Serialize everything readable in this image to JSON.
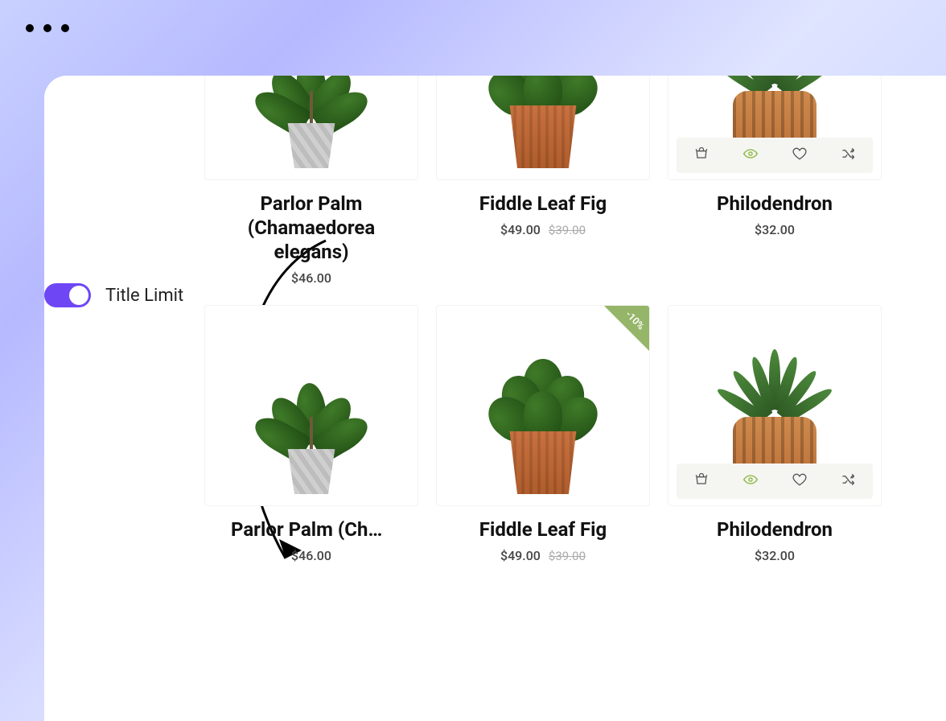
{
  "toggle": {
    "label": "Title Limit",
    "on": true
  },
  "badge_text": "-10%",
  "icons": {
    "cart": "cart-icon",
    "eye": "eye-icon",
    "heart": "heart-icon",
    "shuffle": "shuffle-icon"
  },
  "rows": [
    {
      "truncated": false,
      "products": [
        {
          "title": "Parlor Palm (Chamaedorea elegans)",
          "price": "$46.00",
          "old_price": "",
          "actions": false,
          "badge": false,
          "plant": "palm",
          "pot": "gray"
        },
        {
          "title": "Fiddle Leaf Fig",
          "price": "$49.00",
          "old_price": "$39.00",
          "actions": false,
          "badge": false,
          "plant": "fiddle",
          "pot": "terra"
        },
        {
          "title": "Philodendron",
          "price": "$32.00",
          "old_price": "",
          "actions": true,
          "badge": false,
          "plant": "aloe",
          "pot": "ridge"
        }
      ]
    },
    {
      "truncated": true,
      "products": [
        {
          "title": "Parlor Palm (Chamaedorea elegans)",
          "price": "$46.00",
          "old_price": "",
          "actions": false,
          "badge": false,
          "plant": "palm",
          "pot": "gray"
        },
        {
          "title": "Fiddle Leaf Fig",
          "price": "$49.00",
          "old_price": "$39.00",
          "actions": false,
          "badge": true,
          "plant": "fiddle",
          "pot": "terra"
        },
        {
          "title": "Philodendron",
          "price": "$32.00",
          "old_price": "",
          "actions": true,
          "badge": false,
          "plant": "aloe",
          "pot": "ridge"
        }
      ]
    }
  ]
}
